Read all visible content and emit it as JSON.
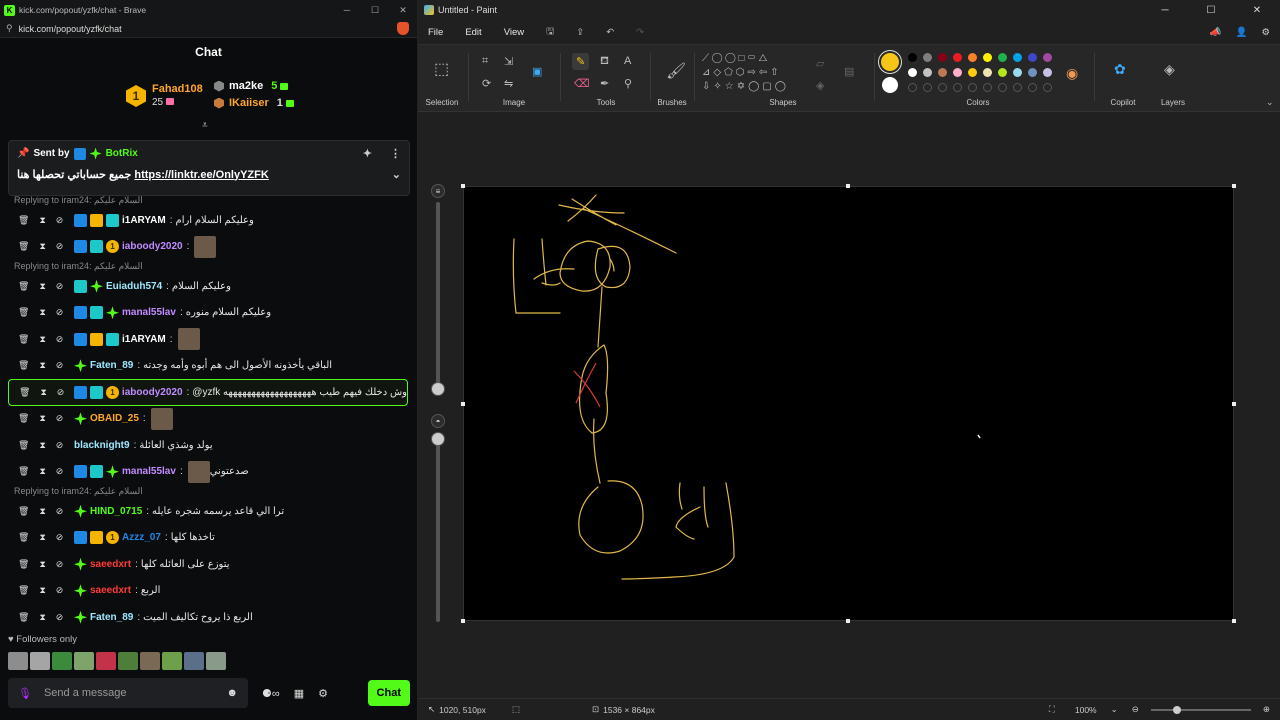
{
  "brave": {
    "window_title": "kick.com/popout/yzfk/chat - Brave",
    "url": "kick.com/popout/yzfk/chat",
    "chat_header": "Chat"
  },
  "leaderboard": {
    "first": {
      "name": "Fahad108",
      "count": "25",
      "rank": "1"
    },
    "second": {
      "name": "ma2ke",
      "count": "5"
    },
    "third": {
      "name": "IKaiiser",
      "count": "1"
    }
  },
  "pinned": {
    "sent_by": "Sent by",
    "sender": "BotRix",
    "message": "جميع حساباتي تحصلها هنا",
    "link": "https://linktr.ee/OnlyYZFK"
  },
  "messages": [
    {
      "reply": "Replying to iram24: السلام عليكم"
    },
    {
      "user": "i1ARYAM",
      "color": "#ffffff",
      "text": "وعليكم السلام ارام",
      "badges": [
        "blue",
        "crown",
        "teal"
      ]
    },
    {
      "user": "iaboody2020",
      "color": "#c08cff",
      "text": "",
      "badges": [
        "blue",
        "teal",
        "one"
      ],
      "emote": true
    },
    {
      "reply": "Replying to iram24: السلام عليكم"
    },
    {
      "user": "Euiaduh574",
      "color": "#9ee8ff",
      "text": "وعليكم السلام",
      "badges": [
        "teal",
        "green"
      ]
    },
    {
      "user": "manal55lav",
      "color": "#c08cff",
      "text": "وعليكم السلام منوره",
      "badges": [
        "blue",
        "teal",
        "green"
      ]
    },
    {
      "user": "i1ARYAM",
      "color": "#ffffff",
      "text": "",
      "badges": [
        "blue",
        "crown",
        "teal"
      ],
      "emote": true
    },
    {
      "user": "Faten_89",
      "color": "#9ee8ff",
      "text": "الباقي يأخذونه الأصول الى هم أبوه وأمه وجدته",
      "badges": [
        "green"
      ]
    },
    {
      "user": "iaboody2020",
      "color": "#c08cff",
      "text": "@yzfk وش دخلك فيهم طيب هههههههههههههههههههه",
      "badges": [
        "blue",
        "teal",
        "one"
      ],
      "highlight": true
    },
    {
      "user": "OBAID_25",
      "color": "#ffa726",
      "text": "",
      "badges": [
        "green"
      ],
      "emote": true
    },
    {
      "user": "blacknight9",
      "color": "#9ee8ff",
      "text": "يولد وشذي العائلة",
      "badges": []
    },
    {
      "user": "manal55lav",
      "color": "#c08cff",
      "text": "صدعتوني",
      "badges": [
        "blue",
        "teal",
        "green"
      ],
      "emote": true
    },
    {
      "reply": "Replying to iram24: السلام عليكم"
    },
    {
      "user": "HIND_0715",
      "color": "#53fc18",
      "text": "ترا الي قاعد يرسمه شجره عايله",
      "badges": [
        "green"
      ]
    },
    {
      "user": "Azzz_07",
      "color": "#1e88e5",
      "text": "تاخذها كلها",
      "badges": [
        "blue",
        "crown",
        "one"
      ]
    },
    {
      "user": "saeedxrt",
      "color": "#ff3b3b",
      "text": "يتوزع على العائله كلها",
      "badges": [
        "green"
      ]
    },
    {
      "user": "saeedxrt",
      "color": "#ff3b3b",
      "text": "الربع",
      "badges": [
        "green"
      ]
    },
    {
      "user": "Faten_89",
      "color": "#9ee8ff",
      "text": "الربع ذا يروح تكاليف الميت",
      "badges": [
        "green"
      ]
    }
  ],
  "followers_only": "Followers only",
  "composer": {
    "placeholder": "Send a message",
    "chat_button": "Chat"
  },
  "paint": {
    "window_title": "Untitled - Paint",
    "menu": [
      "File",
      "Edit",
      "View"
    ],
    "groups": {
      "selection": "Selection",
      "image": "Image",
      "tools": "Tools",
      "brushes": "Brushes",
      "shapes": "Shapes",
      "colors": "Colors",
      "copilot": "Copilot",
      "layers": "Layers"
    },
    "primary_color": "#f5c518",
    "secondary_color": "#ffffff",
    "status": {
      "cursor": "1020, 510px",
      "canvas_size": "1536 × 864px",
      "zoom": "100%"
    }
  }
}
